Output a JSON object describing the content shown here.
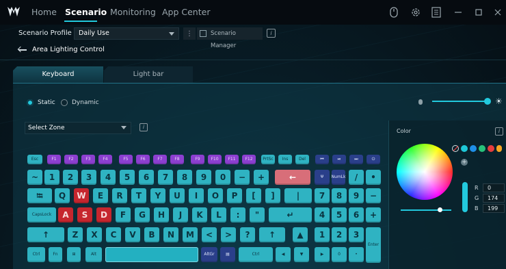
{
  "nav": {
    "tabs": [
      {
        "label": "Home"
      },
      {
        "label": "Scenario"
      },
      {
        "label": "Monitoring"
      },
      {
        "label": "App Center"
      }
    ],
    "active": "Scenario"
  },
  "scenario": {
    "profile_label": "Scenario Profile",
    "profile_value": "Daily Use",
    "manager_label": "Scenario Manager",
    "info": "i"
  },
  "page": {
    "back_label": "Area Lighting Control"
  },
  "lighting_tabs": [
    {
      "label": "Keyboard"
    },
    {
      "label": "Light bar"
    }
  ],
  "mode": {
    "static_label": "Static",
    "dynamic_label": "Dynamic",
    "selected": "Static"
  },
  "brightness": {
    "level_percent": 100
  },
  "zone": {
    "label": "Select Zone"
  },
  "keyboard": {
    "row1": [
      "Esc",
      "F1",
      "F2",
      "F3",
      "F4",
      "F5",
      "F6",
      "F7",
      "F8",
      "F9",
      "F10",
      "F11",
      "F12",
      "PrtSc",
      "Ins",
      "Del",
      "⏮",
      "⏯",
      "⏭",
      "⏻"
    ],
    "row2": [
      "~",
      "1",
      "2",
      "3",
      "4",
      "5",
      "6",
      "7",
      "8",
      "9",
      "0",
      "−",
      "+",
      "←",
      "Ψ",
      "NumLk",
      "/",
      "•"
    ],
    "row3": [
      "⭾",
      "Q",
      "W",
      "E",
      "R",
      "T",
      "Y",
      "U",
      "I",
      "O",
      "P",
      "[",
      "]",
      "|",
      "7",
      "8",
      "9",
      "−"
    ],
    "row4": [
      "CapsLock",
      "A",
      "S",
      "D",
      "F",
      "G",
      "H",
      "J",
      "K",
      "L",
      ":",
      "\"",
      "↵",
      "4",
      "5",
      "6",
      "+"
    ],
    "row5": [
      "↑",
      "Z",
      "X",
      "C",
      "V",
      "B",
      "N",
      "M",
      "<",
      ">",
      "?",
      "↑",
      "▲",
      "1",
      "2",
      "3",
      "Enter"
    ],
    "row6": [
      "Ctrl",
      "Fn",
      "⊞",
      "Alt",
      "",
      "AltGr",
      "▤",
      "Ctrl",
      "◀",
      "▼",
      "▶",
      "0",
      "•"
    ],
    "highlighted_red": [
      "W",
      "A",
      "S",
      "D"
    ],
    "highlighted_pink": [
      "←"
    ]
  },
  "color": {
    "label": "Color",
    "presets": [
      "#1ec8d8",
      "#1f8fe8",
      "#27c27a",
      "#e63d3d",
      "#f5a623",
      "#b455e8"
    ],
    "r_label": "R",
    "g_label": "G",
    "b_label": "B",
    "r": "0",
    "g": "174",
    "b": "199",
    "add_label": "+"
  }
}
